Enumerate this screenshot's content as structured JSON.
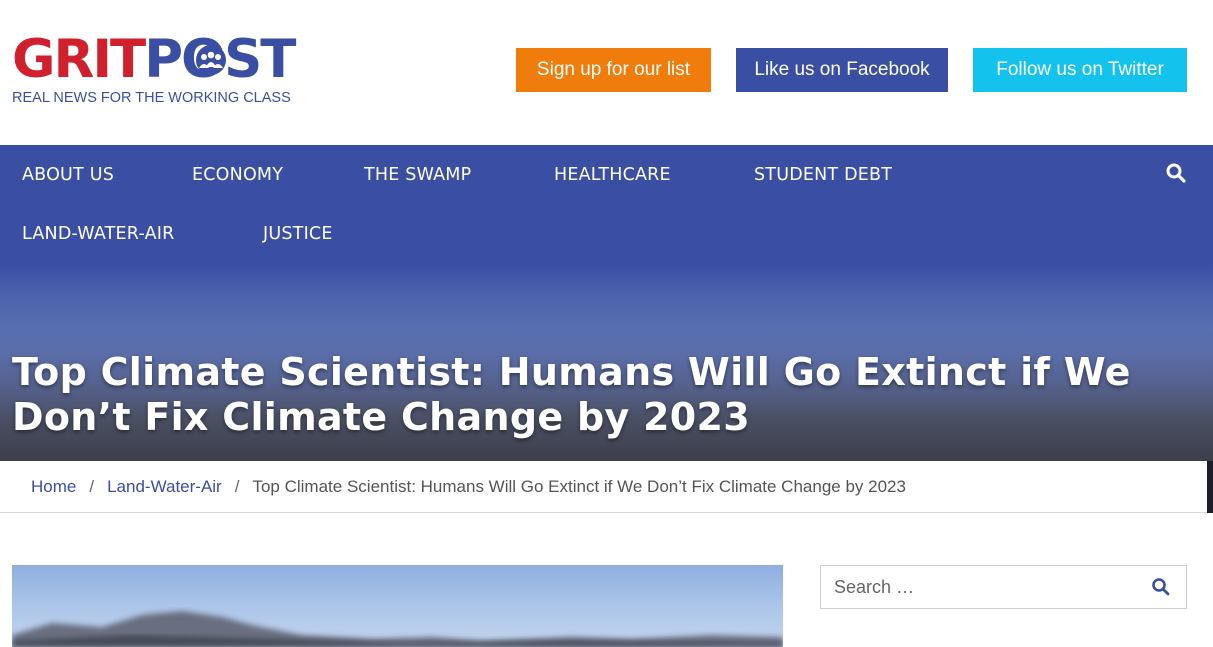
{
  "logo": {
    "word_part1": "GRIT",
    "word_part2": "POST",
    "tagline": "REAL NEWS FOR THE WORKING CLASS"
  },
  "header_buttons": {
    "signup": "Sign up for our list",
    "facebook": "Like us on Facebook",
    "twitter": "Follow us on Twitter"
  },
  "nav": {
    "items": [
      {
        "label": "ABOUT US"
      },
      {
        "label": "ECONOMY"
      },
      {
        "label": "THE SWAMP"
      },
      {
        "label": "HEALTHCARE"
      },
      {
        "label": "STUDENT DEBT"
      },
      {
        "label": "LAND-WATER-AIR"
      },
      {
        "label": "JUSTICE"
      }
    ],
    "search_icon": "search-icon"
  },
  "article": {
    "title": "Top Climate Scientist: Humans Will Go Extinct if We Don’t Fix Climate Change by 2023"
  },
  "breadcrumb": {
    "home": "Home",
    "separator": "/",
    "category": "Land-Water-Air",
    "current": "Top Climate Scientist: Humans Will Go Extinct if We Don’t Fix Climate Change by 2023"
  },
  "sidebar": {
    "search_placeholder": "Search …"
  },
  "colors": {
    "brand_red": "#d0202d",
    "brand_blue": "#3a4fa3",
    "orange": "#f07c0c",
    "twitter_blue": "#14c2ee"
  }
}
